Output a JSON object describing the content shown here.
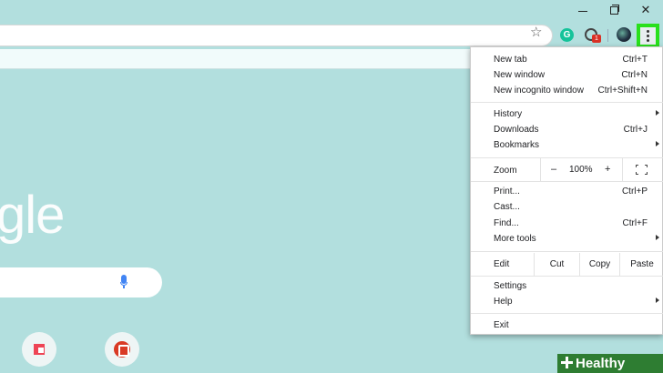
{
  "window": {
    "minimize_glyph": "",
    "maximize_glyph": "",
    "close_glyph": "✕"
  },
  "toolbar": {
    "star_glyph": "☆",
    "grammarly_letter": "G",
    "extension_badge": "1"
  },
  "page": {
    "logo_fragment": "gle"
  },
  "menu": {
    "new_tab": {
      "label": "New tab",
      "shortcut": "Ctrl+T"
    },
    "new_window": {
      "label": "New window",
      "shortcut": "Ctrl+N"
    },
    "new_incognito": {
      "label": "New incognito window",
      "shortcut": "Ctrl+Shift+N"
    },
    "history": {
      "label": "History"
    },
    "downloads": {
      "label": "Downloads",
      "shortcut": "Ctrl+J"
    },
    "bookmarks": {
      "label": "Bookmarks"
    },
    "zoom": {
      "label": "Zoom",
      "minus": "–",
      "value": "100%",
      "plus": "+"
    },
    "print": {
      "label": "Print...",
      "shortcut": "Ctrl+P"
    },
    "cast": {
      "label": "Cast..."
    },
    "find": {
      "label": "Find...",
      "shortcut": "Ctrl+F"
    },
    "more_tools": {
      "label": "More tools"
    },
    "edit": {
      "label": "Edit",
      "cut": "Cut",
      "copy": "Copy",
      "paste": "Paste"
    },
    "settings": {
      "label": "Settings"
    },
    "help": {
      "label": "Help"
    },
    "exit": {
      "label": "Exit"
    }
  },
  "watermark": {
    "text": "Healthy Living"
  },
  "colors": {
    "page_background": "#b2dfde",
    "menu_button_highlight": "#29e01c",
    "watermark": "#2e7d32"
  }
}
